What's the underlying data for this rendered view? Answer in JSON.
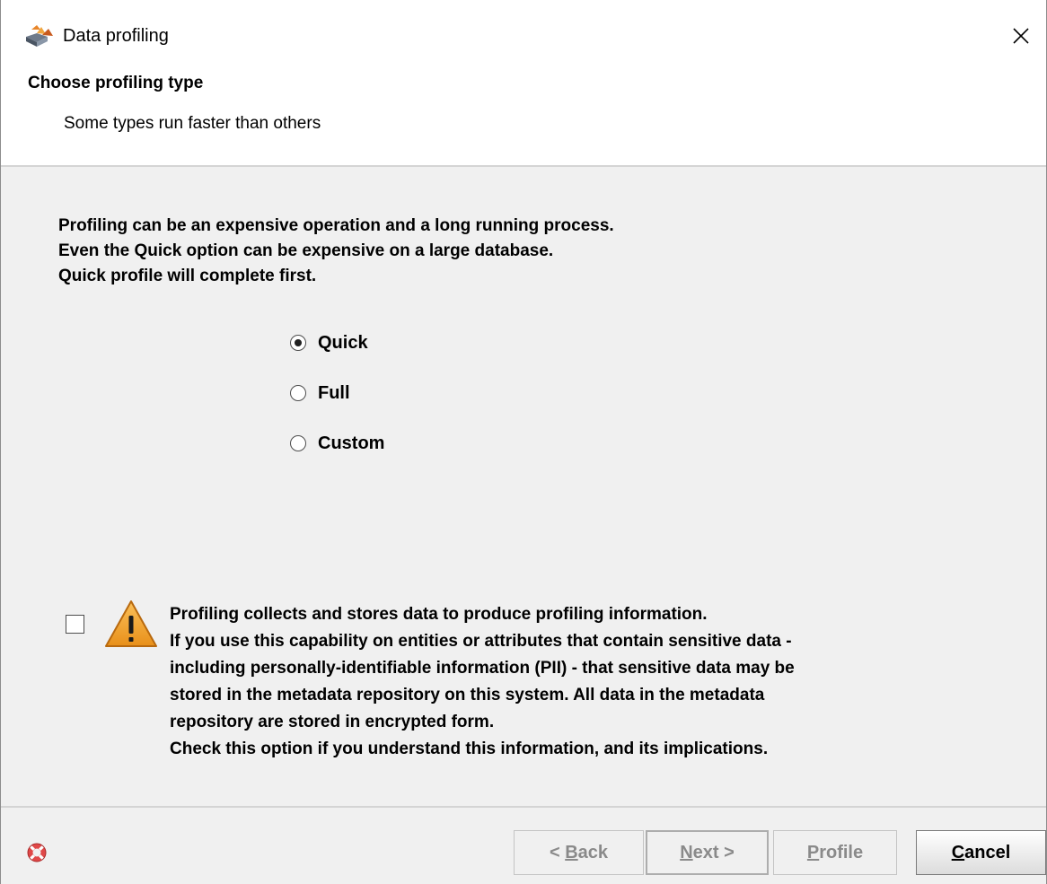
{
  "window": {
    "title": "Data profiling",
    "app_icon": "data-profiling-app-icon",
    "close_icon": "close-icon"
  },
  "header": {
    "title": "Choose profiling type",
    "subtitle": "Some types run faster than others"
  },
  "content": {
    "intro_lines": [
      "Profiling can be an expensive operation and a long running process.",
      "Even the Quick option can be expensive on a large database.",
      "Quick profile will complete first."
    ],
    "profiling_types": [
      {
        "label": "Quick",
        "selected": true
      },
      {
        "label": "Full",
        "selected": false
      },
      {
        "label": "Custom",
        "selected": false
      }
    ],
    "consent": {
      "checked": false,
      "icon": "warning-icon",
      "lines": [
        "Profiling collects and stores data to produce profiling information.",
        "If you use this capability on entities or attributes that contain sensitive data -",
        "including personally-identifiable information (PII) - that sensitive data may be",
        "stored in the metadata repository on this system. All data in the metadata",
        "repository are stored in encrypted form.",
        "Check this option if you understand this information, and its implications."
      ]
    }
  },
  "footer": {
    "help_icon": "help-lifebuoy-icon",
    "buttons": {
      "back": {
        "prefix": "< ",
        "mnemonic": "B",
        "rest": "ack",
        "enabled": false
      },
      "next": {
        "prefix": "",
        "mnemonic": "N",
        "rest": "ext >",
        "enabled": false
      },
      "profile": {
        "prefix": "",
        "mnemonic": "P",
        "rest": "rofile",
        "enabled": false
      },
      "cancel": {
        "prefix": "",
        "mnemonic": "C",
        "rest": "ancel",
        "enabled": true
      }
    }
  },
  "colors": {
    "panel_bg": "#f0f0f0",
    "header_bg": "#ffffff",
    "warning_fill": "#f5a623",
    "disabled_text": "#8a8a8a"
  }
}
